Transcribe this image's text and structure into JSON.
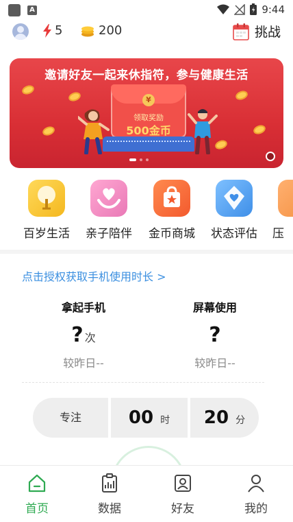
{
  "status_bar": {
    "time": "9:44"
  },
  "top_bar": {
    "energy_count": "5",
    "coin_count": "200",
    "challenge_label": "挑战"
  },
  "banner": {
    "headline": "邀请好友一起来休指符，参与健康生活",
    "envelope_caption": "领取奖励",
    "envelope_reward": "500金币"
  },
  "quick_links": [
    {
      "label": "百岁生活",
      "icon": "tree-icon",
      "color": "#f4b81f"
    },
    {
      "label": "亲子陪伴",
      "icon": "heart-hands-icon",
      "color": "#e979b6"
    },
    {
      "label": "金币商城",
      "icon": "shopping-bag-icon",
      "color": "#f35a2e"
    },
    {
      "label": "状态评估",
      "icon": "shield-heart-icon",
      "color": "#3f8fe8"
    },
    {
      "label": "压",
      "icon": "partial-icon",
      "color": "#f49142"
    }
  ],
  "usage": {
    "permission_link": "点击授权获取手机使用时长 >",
    "pickup": {
      "title": "拿起手机",
      "value": "?",
      "unit": "次",
      "compare": "较昨日--"
    },
    "screen": {
      "title": "屏幕使用",
      "value": "?",
      "compare": "较昨日--"
    }
  },
  "focus": {
    "label": "专注",
    "hours": "00",
    "hours_unit": "时",
    "minutes": "20",
    "minutes_unit": "分"
  },
  "tabs": [
    {
      "label": "首页",
      "icon": "home-icon",
      "active": true
    },
    {
      "label": "数据",
      "icon": "data-clipboard-icon",
      "active": false
    },
    {
      "label": "好友",
      "icon": "friends-icon",
      "active": false
    },
    {
      "label": "我的",
      "icon": "profile-icon",
      "active": false
    }
  ],
  "colors": {
    "accent_green": "#2faa52",
    "link_blue": "#3b8fe0",
    "banner_red": "#d92f35"
  }
}
